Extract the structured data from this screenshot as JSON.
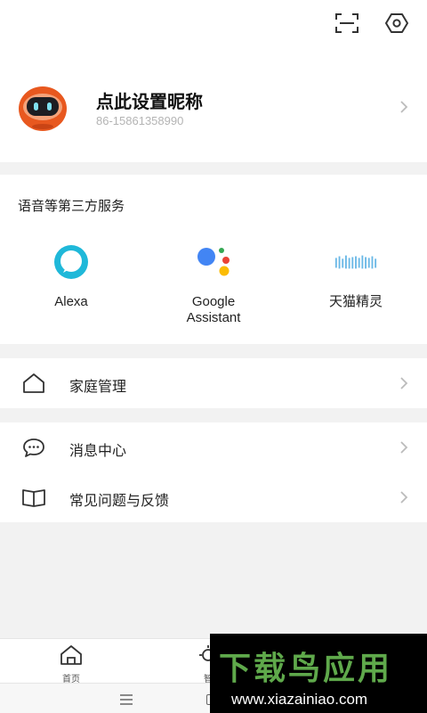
{
  "topbar": {
    "icons": [
      "scan-icon",
      "settings-hex-icon"
    ]
  },
  "profile": {
    "nickname": "点此设置昵称",
    "phone": "86-15861358990"
  },
  "services": {
    "title": "语音等第三方服务",
    "items": [
      {
        "label": "Alexa",
        "icon": "alexa-icon"
      },
      {
        "label": "Google Assistant",
        "icon": "google-assistant-icon"
      },
      {
        "label": "天猫精灵",
        "icon": "tmall-genie-icon"
      }
    ]
  },
  "menu": {
    "home": {
      "label": "家庭管理",
      "icon": "house-icon"
    },
    "messages": {
      "label": "消息中心",
      "icon": "chat-bubble-icon"
    },
    "faq": {
      "label": "常见问题与反馈",
      "icon": "book-icon"
    }
  },
  "bottom_nav": {
    "home_label": "首页",
    "smart_label": "智"
  },
  "watermark": {
    "title": "下载鸟应用",
    "url": "www.xiazainiao.com"
  },
  "colors": {
    "accent": "#5fa94b",
    "avatar": "#e8581f",
    "alexa": "#1fb8d9"
  }
}
